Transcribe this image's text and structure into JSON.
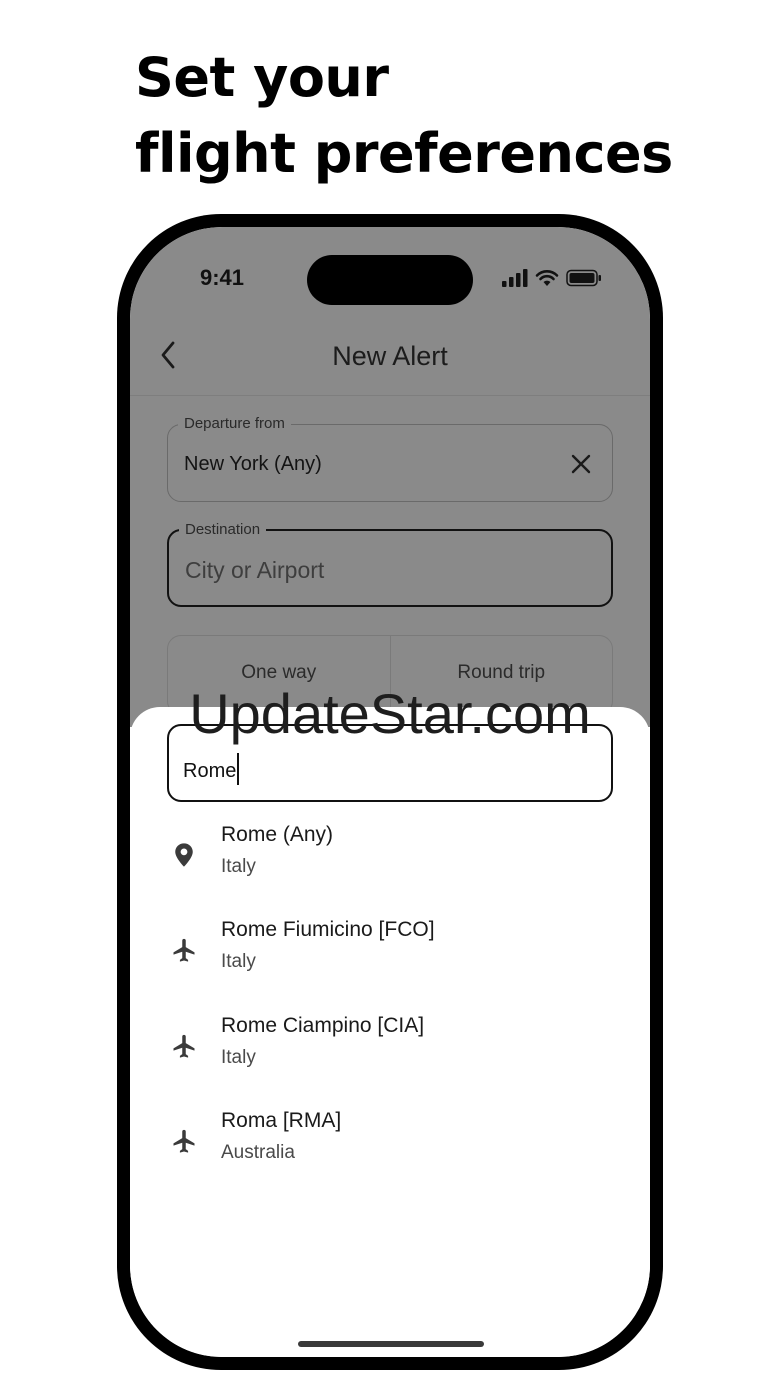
{
  "headline": {
    "line1": "Set your",
    "line2": "flight preferences"
  },
  "status_bar": {
    "time": "9:41",
    "icons": [
      "signal-icon",
      "wifi-icon",
      "battery-icon"
    ]
  },
  "nav": {
    "title": "New Alert",
    "back_icon": "chevron-left-icon"
  },
  "form": {
    "departure": {
      "label": "Departure from",
      "value": "New York (Any)",
      "clear_icon": "close-icon"
    },
    "destination": {
      "label": "Destination",
      "placeholder": "City or Airport"
    },
    "trip_type": {
      "options": [
        "One way",
        "Round trip"
      ]
    }
  },
  "watermark": "UpdateStar.com",
  "search": {
    "value": "Rome"
  },
  "results": [
    {
      "icon": "location-pin-icon",
      "title": "Rome (Any)",
      "subtitle": "Italy"
    },
    {
      "icon": "airplane-icon",
      "title": "Rome Fiumicino [FCO]",
      "subtitle": "Italy"
    },
    {
      "icon": "airplane-icon",
      "title": "Rome Ciampino [CIA]",
      "subtitle": "Italy"
    },
    {
      "icon": "airplane-icon",
      "title": "Roma [RMA]",
      "subtitle": "Australia"
    }
  ],
  "colors": {
    "overlay": "#8a8a8a",
    "sheet": "#ffffff",
    "text": "#1a1a1a",
    "secondary_text": "#4a4a4a"
  }
}
